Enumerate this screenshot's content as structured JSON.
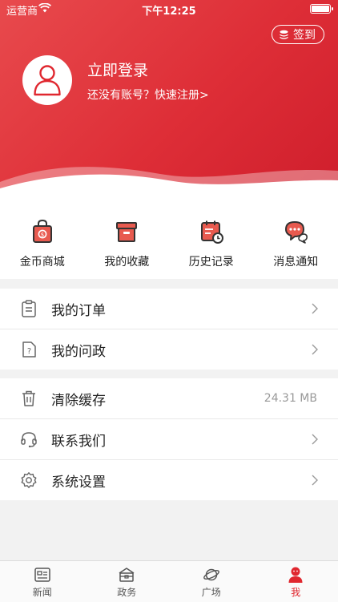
{
  "status_bar": {
    "carrier": "运营商",
    "time": "下午12:25"
  },
  "header": {
    "sign_in_label": "签到",
    "login_title": "立即登录",
    "login_subtitle": "还没有账号？快速注册>"
  },
  "quick_links": [
    {
      "label": "金币商城",
      "icon": "coin-bag-icon"
    },
    {
      "label": "我的收藏",
      "icon": "box-icon"
    },
    {
      "label": "历史记录",
      "icon": "calendar-clock-icon"
    },
    {
      "label": "消息通知",
      "icon": "chat-bubble-icon"
    }
  ],
  "menu_group_1": [
    {
      "label": "我的订单",
      "icon": "clipboard-icon"
    },
    {
      "label": "我的问政",
      "icon": "question-doc-icon"
    }
  ],
  "menu_group_2": [
    {
      "label": "清除缓存",
      "icon": "trash-icon",
      "value": "24.31 MB"
    },
    {
      "label": "联系我们",
      "icon": "headset-icon"
    },
    {
      "label": "系统设置",
      "icon": "gear-icon"
    }
  ],
  "tabs": [
    {
      "label": "新闻",
      "icon": "news-icon"
    },
    {
      "label": "政务",
      "icon": "government-icon"
    },
    {
      "label": "广场",
      "icon": "planet-icon"
    },
    {
      "label": "我",
      "icon": "person-icon",
      "active": true
    }
  ],
  "colors": {
    "brand_red": "#e0272f",
    "icon_gray": "#666666",
    "background": "#f2f2f2"
  }
}
